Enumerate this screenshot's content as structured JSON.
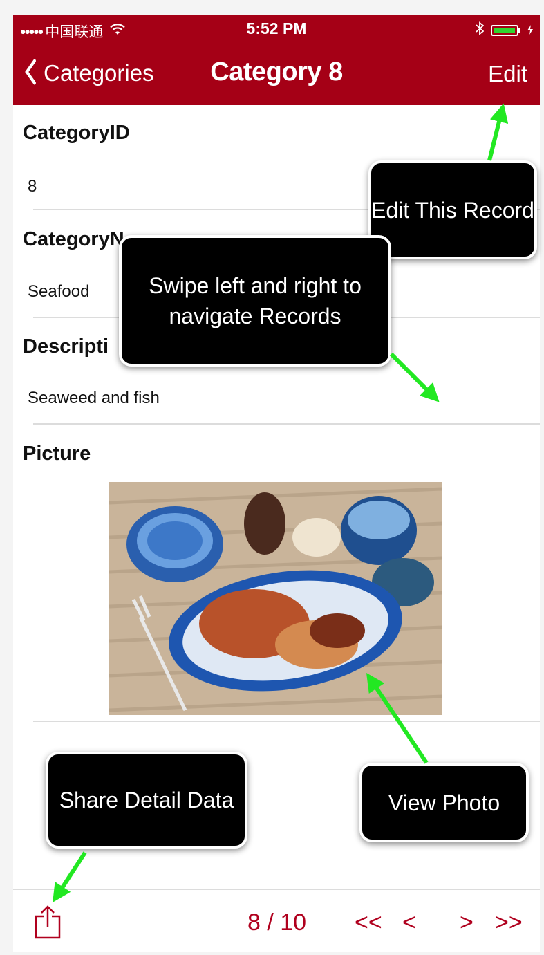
{
  "status_bar": {
    "signal": "●●●●●",
    "carrier": "中国联通",
    "time": "5:52 PM"
  },
  "nav": {
    "back_label": "Categories",
    "title": "Category 8",
    "edit_label": "Edit"
  },
  "fields": [
    {
      "label": "CategoryID",
      "value": "8"
    },
    {
      "label": "CategoryN",
      "value": "Seafood"
    },
    {
      "label": "Descripti",
      "value": "Seaweed and fish"
    },
    {
      "label": "Picture",
      "value": ""
    }
  ],
  "callouts": {
    "edit": "Edit This Record",
    "swipe": "Swipe left and right to navigate Records",
    "share": "Share Detail Data",
    "photo": "View Photo"
  },
  "toolbar": {
    "page": "8 / 10",
    "first": "<<",
    "prev": "<",
    "next": ">",
    "last": ">>"
  },
  "colors": {
    "nav_bar": "#a50016",
    "tint": "#b0001e",
    "arrow": "#22e822",
    "battery": "#2fd52f"
  },
  "icons": [
    "chevron-left-icon",
    "wifi-icon",
    "bluetooth-icon",
    "battery-icon",
    "share-icon"
  ]
}
